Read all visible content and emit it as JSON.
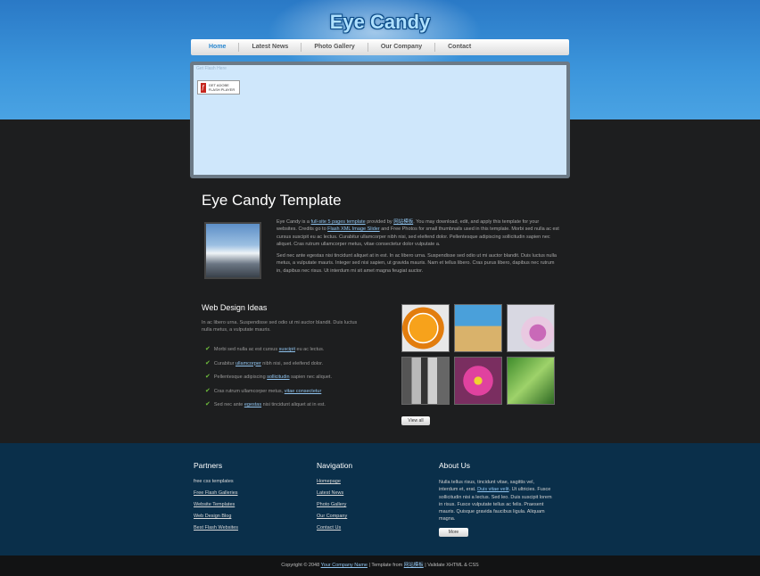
{
  "header": {
    "logo_text": "Eye Candy"
  },
  "nav": {
    "items": [
      "Home",
      "Latest News",
      "Photo Gallery",
      "Our Company",
      "Contact"
    ]
  },
  "flash": {
    "top_text": "Get Flash Here",
    "badge_icon": "flash-icon",
    "badge_text": "GET ADOBE FLASH PLAYER"
  },
  "intro": {
    "title": "Eye Candy Template",
    "p1_before": "Eye Candy is a ",
    "p1_link1": "full-site 5 pages template",
    "p1_mid1": " provided by ",
    "p1_link2": "网站模板",
    "p1_mid2": ". You may download, edit, and apply this template for your websites. Credits go to ",
    "p1_link3": "Flash XML Image Slider",
    "p1_after": " and Free Photos for small thumbnails used in this template. Morbi sed nulla ac est cursus suscipit eu ac lectus. Curabitur ullamcorper nibh nisi, sed eleifend dolor. Pellentesque adipiscing sollicitudin sapien nec aliquet. Cras rutrum ullamcorper metus, vitae consectetur dolor vulputate a.",
    "p2": "Sed nec ante egestas nisi tincidunt aliquet at in est. In ac libero urna. Suspendisse sed odio ut mi auctor blandit. Duis luctus nulla metus, a vulputate mauris. Integer sed nisi sapien, ut gravida mauris. Nam et tellus libero. Cras purus libero, dapibus nec rutrum in, dapibus nec risus. Ut interdum mi sit amet magna feugiat auctor."
  },
  "ideas": {
    "title": "Web Design Ideas",
    "text": "In ac libero urna. Suspendisse sed odio ut mi auctor blandit. Duis luctus nulla metus, a vulputate mauris.",
    "items": [
      {
        "before": "Morbi sed nulla ac est cursus ",
        "link": "suscipit",
        "after": " eu ac lectus."
      },
      {
        "before": "Curabitur ",
        "link": "ullamcorper",
        "after": " nibh nisi, sed eleifend dolor."
      },
      {
        "before": "Pellentesque adipiscing ",
        "link": "sollicitudin",
        "after": " sapien nec aliquet."
      },
      {
        "before": "Cras rutrum ullamcorper metus, ",
        "link": "vitae consectetur",
        "after": ""
      },
      {
        "before": "Sed nec ante ",
        "link": "egestas",
        "after": " nisi tincidunt aliquet at in est."
      }
    ],
    "view_all": "View all"
  },
  "footer": {
    "partners": {
      "title": "Partners",
      "items": [
        "free css templates",
        "Free Flash Galleries",
        "Website Templates",
        "Web Design Blog",
        "Best Flash Websites"
      ]
    },
    "navigation": {
      "title": "Navigation",
      "items": [
        "Homepage",
        "Latest News",
        "Photo Gallery",
        "Our Company",
        "Contact Us"
      ]
    },
    "about": {
      "title": "About Us",
      "text_before": "Nulla tellus risus, tincidunt vitae, sagittis vel, interdum et, erat. ",
      "text_link": "Duis vitae velit",
      "text_after": ". Ut ultricies. Fusce sollicitudin nisi a lectus. Sed leo. Duis suscipit lorem in risus. Fusce vulputate tellus ac felis. Praesent mauris. Quisque gravida faucibus ligula. Aliquam magna.",
      "more": "More"
    }
  },
  "copyright": {
    "before": "Copyright © 2048 ",
    "company": "Your Company Name",
    "mid": " | Template from ",
    "source": "网站模板",
    "after": " | Validate XHTML & CSS"
  }
}
